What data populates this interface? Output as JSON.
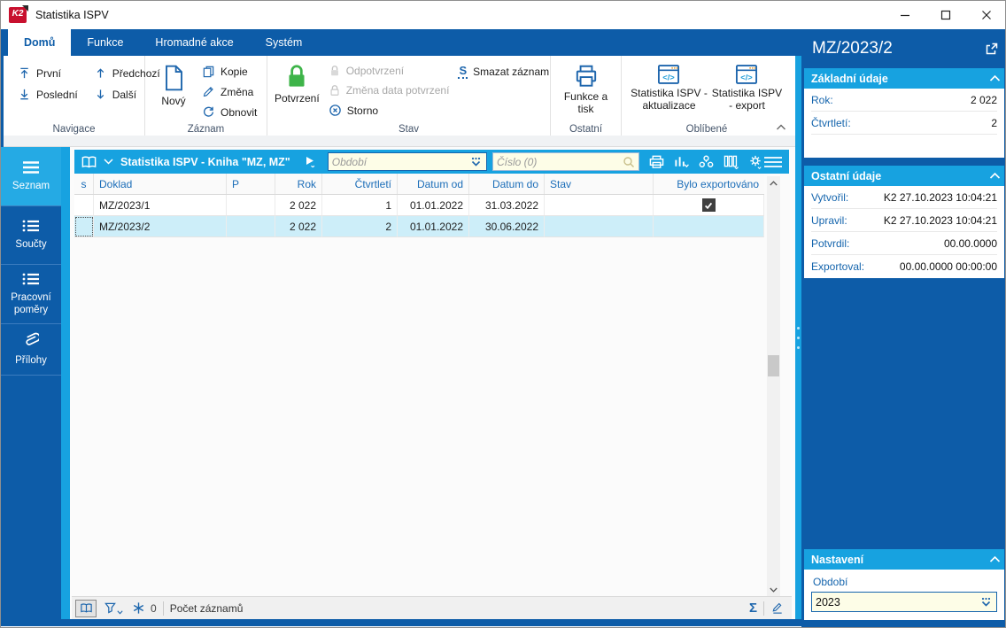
{
  "window": {
    "title": "Statistika ISPV"
  },
  "tabs": {
    "items": [
      "Domů",
      "Funkce",
      "Hromadné akce",
      "Systém"
    ],
    "active": "Domů"
  },
  "ribbon": {
    "groups": [
      {
        "label": "Navigace",
        "items": [
          "První",
          "Předchozí",
          "Poslední",
          "Další"
        ]
      },
      {
        "label": "Záznam",
        "big": "Nový",
        "items": [
          "Kopie",
          "Změna",
          "Obnovit"
        ]
      },
      {
        "label": "Stav",
        "big": "Potvrzení",
        "items": [
          "Odpotvrzení",
          "Změna data potvrzení",
          "Storno",
          "Smazat záznam"
        ]
      },
      {
        "label": "Ostatní",
        "big": "Funkce a tisk"
      },
      {
        "label": "Oblíbené",
        "items": [
          "Statistika ISPV - aktualizace",
          "Statistika ISPV - export"
        ]
      }
    ]
  },
  "glyphs": {
    "smazat": "S",
    "sigma": "Σ",
    "code": "</>"
  },
  "sidebar": {
    "items": [
      "Seznam",
      "Součty",
      "Pracovní poměry",
      "Přílohy"
    ],
    "active": "Seznam"
  },
  "grid": {
    "title": "Statistika ISPV - Kniha \"MZ, MZ\"",
    "filters": {
      "obdobi_placeholder": "Období",
      "cislo_placeholder": "Číslo (0)"
    },
    "columns": [
      "s",
      "Doklad",
      "P",
      "Rok",
      "Čtvrtletí",
      "Datum od",
      "Datum do",
      "Stav",
      "Bylo exportováno"
    ],
    "rows": [
      {
        "doklad": "MZ/2023/1",
        "p": "",
        "rok": "2 022",
        "ctvrtleti": "1",
        "datum_od": "01.01.2022",
        "datum_do": "31.03.2022",
        "stav": "",
        "bylo_exportovano": true,
        "selected": false
      },
      {
        "doklad": "MZ/2023/2",
        "p": "",
        "rok": "2 022",
        "ctvrtleti": "2",
        "datum_od": "01.01.2022",
        "datum_do": "30.06.2022",
        "stav": "",
        "bylo_exportovano": false,
        "selected": true
      }
    ],
    "status": {
      "filter_count": "0",
      "count_label": "Počet záznamů"
    }
  },
  "detail": {
    "title": "MZ/2023/2",
    "zakladni": {
      "title": "Základní údaje",
      "rows": [
        [
          "Rok:",
          "2 022"
        ],
        [
          "Čtvrtletí:",
          "2"
        ]
      ]
    },
    "ostatni": {
      "title": "Ostatní údaje",
      "rows": [
        [
          "Vytvořil:",
          "K2 27.10.2023 10:04:21"
        ],
        [
          "Upravil:",
          "K2 27.10.2023 10:04:21"
        ],
        [
          "Potvrdil:",
          "00.00.0000"
        ],
        [
          "Exportoval:",
          "00.00.0000 00:00:00"
        ]
      ]
    },
    "nastaveni": {
      "title": "Nastavení",
      "field_label": "Období",
      "field_value": "2023"
    }
  },
  "colors": {
    "accent_blue": "#0d5ca8",
    "cyan": "#17a2e0",
    "pale_yellow": "#fdfde7",
    "green": "#3eb449",
    "selected_row": "#cdeef9",
    "logo_red": "#c8102e"
  }
}
